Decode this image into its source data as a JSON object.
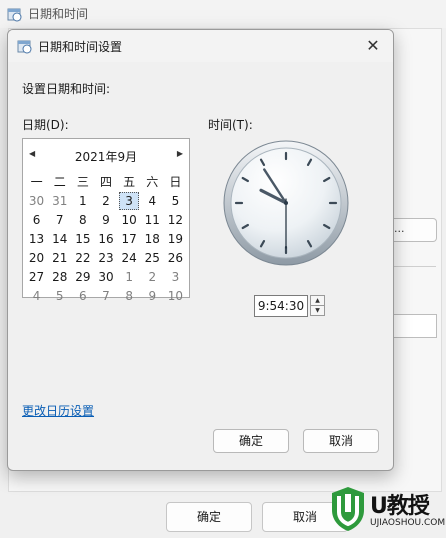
{
  "parent_window": {
    "title": "日期和时间",
    "change_button_label": "...",
    "ok_label": "确定",
    "cancel_label": "取消"
  },
  "dialog": {
    "title": "日期和时间设置",
    "close_glyph": "✕",
    "heading": "设置日期和时间:",
    "date_label": "日期(D):",
    "time_label": "时间(T):",
    "calendar": {
      "prev_glyph": "◀",
      "next_glyph": "▶",
      "month_label": "2021年9月",
      "weekdays": [
        "一",
        "二",
        "三",
        "四",
        "五",
        "六",
        "日"
      ],
      "weeks": [
        [
          "30",
          "31",
          "1",
          "2",
          "3",
          "4",
          "5"
        ],
        [
          "6",
          "7",
          "8",
          "9",
          "10",
          "11",
          "12"
        ],
        [
          "13",
          "14",
          "15",
          "16",
          "17",
          "18",
          "19"
        ],
        [
          "20",
          "21",
          "22",
          "23",
          "24",
          "25",
          "26"
        ],
        [
          "27",
          "28",
          "29",
          "30",
          "1",
          "2",
          "3"
        ],
        [
          "4",
          "5",
          "6",
          "7",
          "8",
          "9",
          "10"
        ]
      ],
      "selected_day": "3"
    },
    "clock": {
      "hour": 9,
      "minute": 54,
      "second": 30
    },
    "time_value": "9:54:30",
    "change_calendar_link": "更改日历设置",
    "ok_label": "确定",
    "cancel_label": "取消"
  },
  "watermark": {
    "brand": "U教授",
    "url": "UJIAOSHOU.COM"
  },
  "colors": {
    "link": "#0a5eb5",
    "selection": "#cfe3f7",
    "watermark_green": "#2e9a3c"
  }
}
